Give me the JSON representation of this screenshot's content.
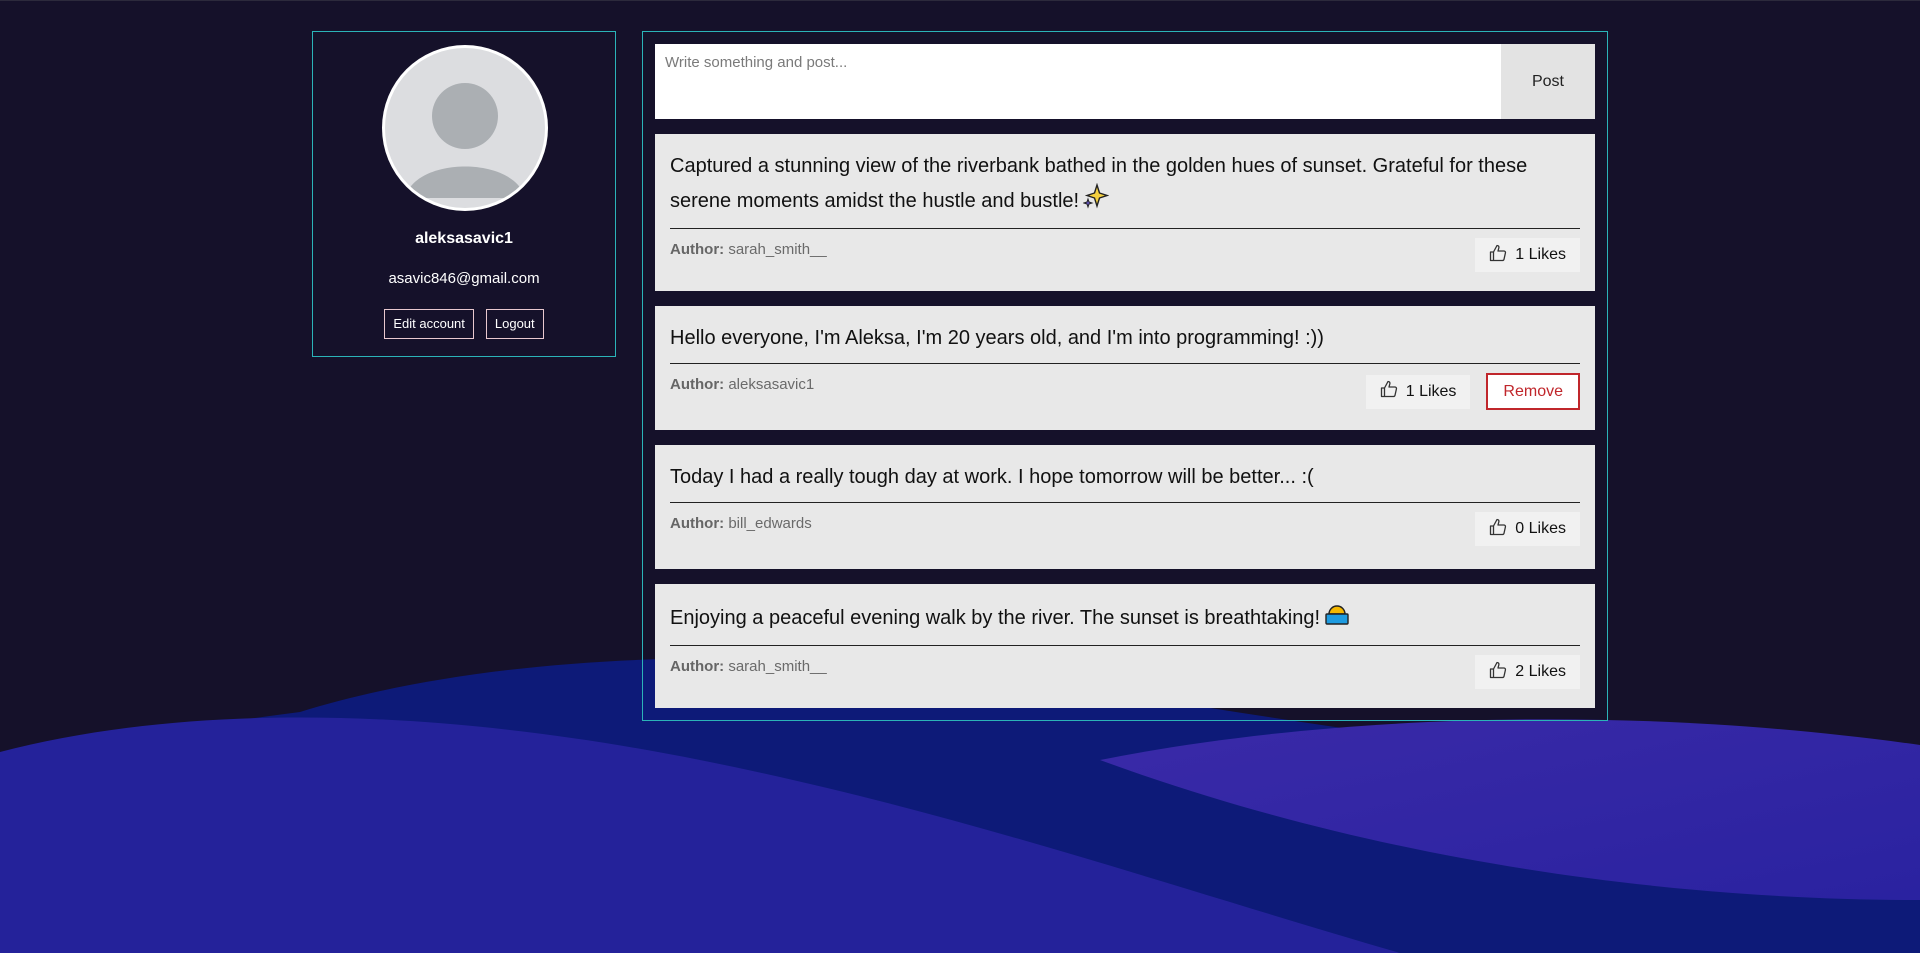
{
  "colors": {
    "background": "#15112a",
    "accent_border": "#2bb3b8",
    "card_bg": "#e8e8e8",
    "remove_red": "#c0262b",
    "wave_blue": "#24229a"
  },
  "profile": {
    "username": "aleksasavic1",
    "email": "asavic846@gmail.com",
    "edit_label": "Edit account",
    "logout_label": "Logout",
    "avatar_icon": "user-silhouette-icon"
  },
  "composer": {
    "placeholder": "Write something and post...",
    "post_label": "Post"
  },
  "posts": [
    {
      "text": "Captured a stunning view of the riverbank bathed in the golden hues of sunset. Grateful for these serene moments amidst the hustle and bustle!",
      "emoji": "sparkles-icon",
      "author_label": "Author:",
      "author": "sarah_smith__",
      "likes": "1 Likes",
      "removable": false
    },
    {
      "text": "Hello everyone, I'm Aleksa, I'm 20 years old, and I'm into programming! :))",
      "author_label": "Author:",
      "author": "aleksasavic1",
      "likes": "1 Likes",
      "remove_label": "Remove",
      "removable": true
    },
    {
      "text": "Today I had a really tough day at work. I hope tomorrow will be better... :(",
      "author_label": "Author:",
      "author": "bill_edwards",
      "likes": "0 Likes",
      "removable": false
    },
    {
      "text": "Enjoying a peaceful evening walk by the river. The sunset is breathtaking!",
      "emoji": "sunset-icon",
      "author_label": "Author:",
      "author": "sarah_smith__",
      "likes": "2 Likes",
      "removable": false
    }
  ]
}
